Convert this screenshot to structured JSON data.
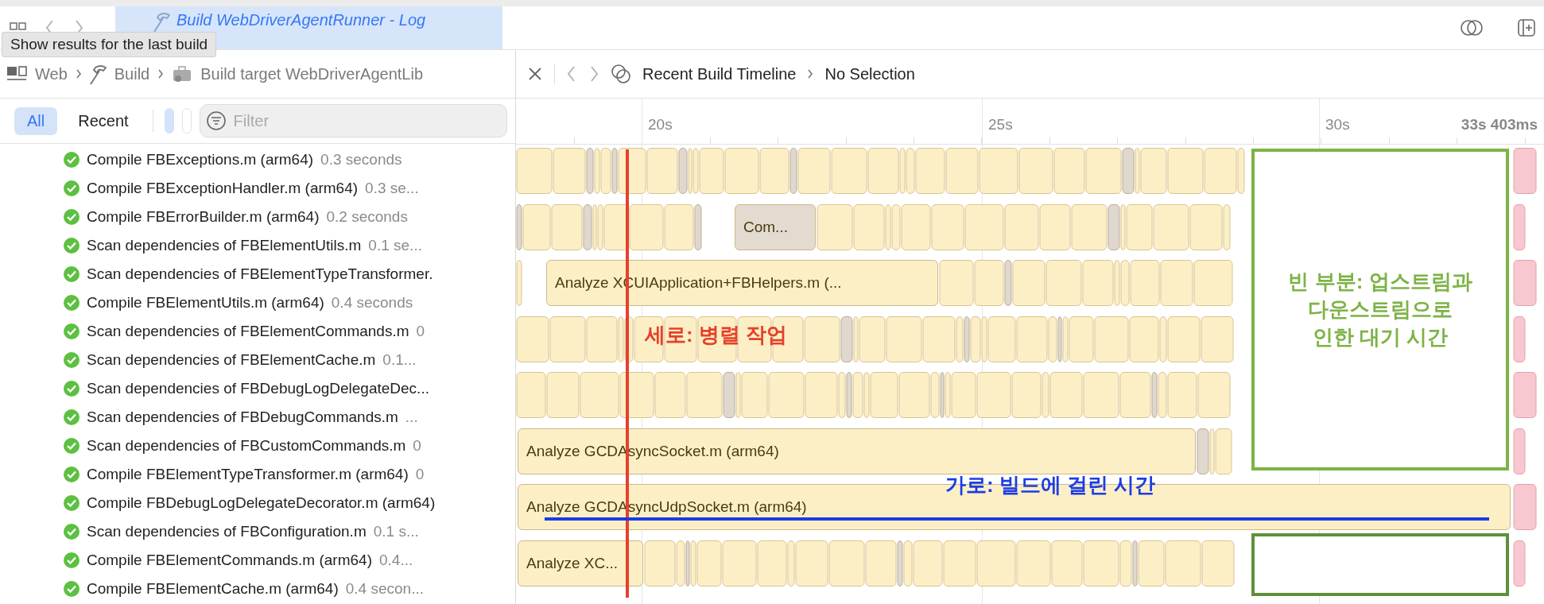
{
  "window": {
    "tab": {
      "title": "Build WebDriverAgentRunner - Log",
      "selected": true
    },
    "tooltip": "Show results for the last build"
  },
  "navigator": {
    "breadcrumb": [
      "Web",
      "Build",
      "Build target WebDriverAgentLib"
    ],
    "scopes": [
      {
        "label": "All",
        "selected": true
      },
      {
        "label": "Recent",
        "selected": false
      }
    ],
    "filter": {
      "placeholder": "Filter"
    },
    "items": [
      {
        "title": "Compile FBExceptions.m (arm64)",
        "duration": "0.3 seconds"
      },
      {
        "title": "Compile FBExceptionHandler.m (arm64)",
        "duration": "0.3 se..."
      },
      {
        "title": "Compile FBErrorBuilder.m (arm64)",
        "duration": "0.2 seconds"
      },
      {
        "title": "Scan dependencies of FBElementUtils.m",
        "duration": "0.1 se..."
      },
      {
        "title": "Scan dependencies of FBElementTypeTransformer."
      },
      {
        "title": "Compile FBElementUtils.m (arm64)",
        "duration": "0.4 seconds"
      },
      {
        "title": "Scan dependencies of FBElementCommands.m",
        "duration": "0"
      },
      {
        "title": "Scan dependencies of FBElementCache.m",
        "duration": "0.1..."
      },
      {
        "title": "Scan dependencies of FBDebugLogDelegateDec..."
      },
      {
        "title": "Scan dependencies of FBDebugCommands.m",
        "duration": "..."
      },
      {
        "title": "Scan dependencies of FBCustomCommands.m",
        "duration": "0"
      },
      {
        "title": "Compile FBElementTypeTransformer.m (arm64)",
        "duration": "0"
      },
      {
        "title": "Compile FBDebugLogDelegateDecorator.m (arm64)"
      },
      {
        "title": "Scan dependencies of FBConfiguration.m",
        "duration": "0.1 s..."
      },
      {
        "title": "Compile FBElementCommands.m (arm64)",
        "duration": "0.4..."
      },
      {
        "title": "Compile FBElementCache.m (arm64)",
        "duration": "0.4 secon..."
      }
    ]
  },
  "timeline": {
    "breadcrumb": [
      "Recent Build Timeline",
      "No Selection"
    ],
    "ruler": [
      "20s",
      "25s",
      "30s",
      "33s 403ms"
    ],
    "tasks": [
      {
        "label": "Com...",
        "color": "#e3dbd0"
      },
      {
        "label": "Analyze XCUIApplication+FBHelpers.m (...",
        "color": "#fcefc6"
      },
      {
        "label": "Analyze GCDAsyncSocket.m (arm64)",
        "color": "#fcefc6"
      },
      {
        "label": "Analyze GCDAsyncUdpSocket.m (arm64)",
        "color": "#fcefc6"
      },
      {
        "label": "Analyze XC...",
        "color": "#fcefc6"
      }
    ],
    "annotations": [
      {
        "kind": "vertical",
        "text": "세로: 병렬 작업",
        "color": "#e5412b"
      },
      {
        "kind": "horizontal",
        "text": "가로: 빌드에 걸린 시간",
        "color": "#1a3ce6"
      },
      {
        "kind": "frame",
        "text": "빈 부분: 업스트림과\n다운스트림으로\n인한 대기 시간",
        "color": "#7db346"
      },
      {
        "kind": "frame",
        "color": "#5f8f3a"
      }
    ]
  }
}
